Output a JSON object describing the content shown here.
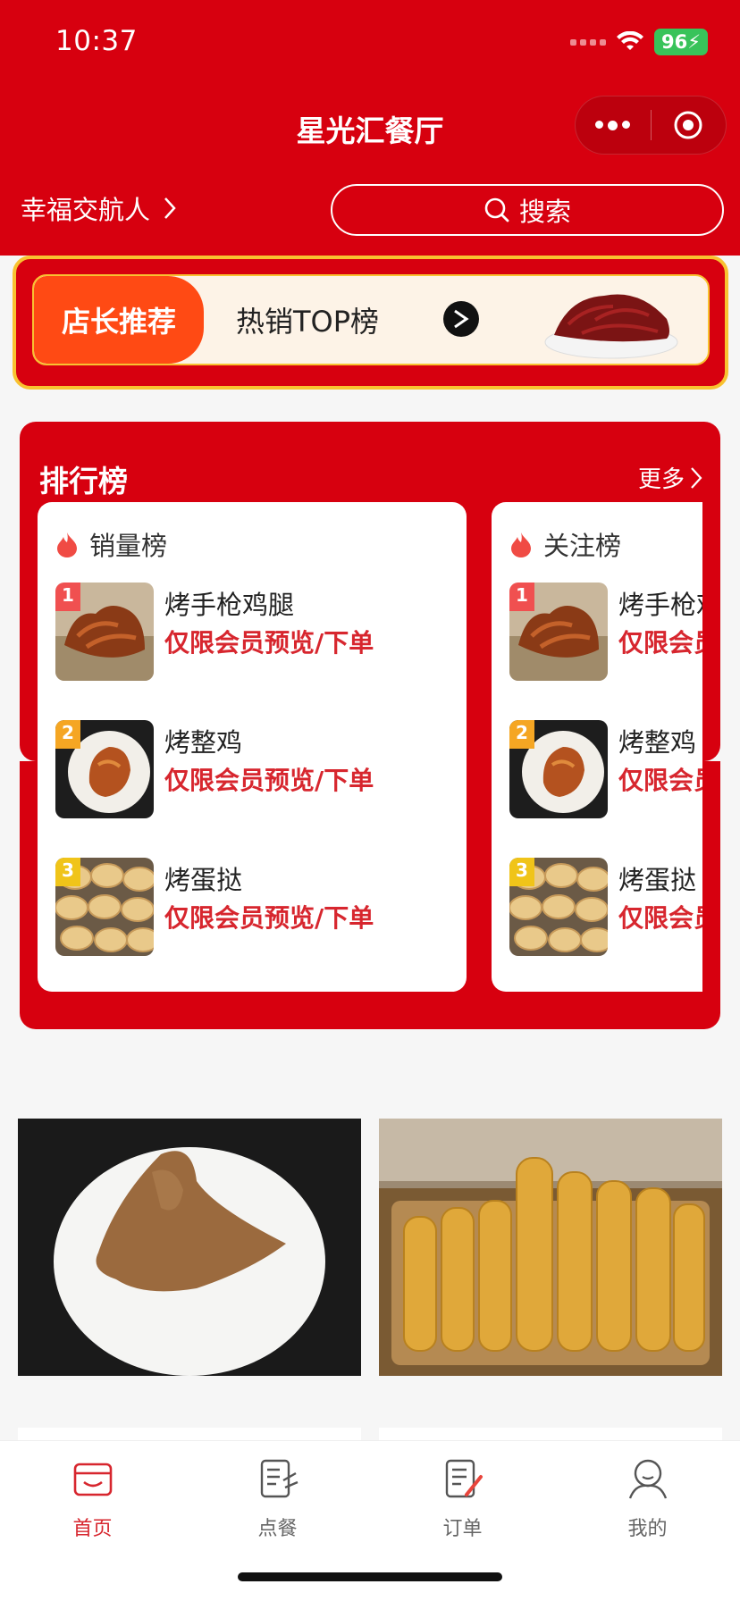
{
  "status_bar": {
    "time": "10:37",
    "battery": "96"
  },
  "header": {
    "title": "星光汇餐厅",
    "store_name": "幸福交航人",
    "search_label": "搜索"
  },
  "banner": {
    "tag": "店长推荐",
    "text": "热销TOP榜"
  },
  "ranking": {
    "title": "排行榜",
    "more_label": "更多",
    "lists": [
      {
        "title": "销量榜",
        "items": [
          {
            "rank": "1",
            "name": "烤手枪鸡腿",
            "note": "仅限会员预览/下单"
          },
          {
            "rank": "2",
            "name": "烤整鸡",
            "note": "仅限会员预览/下单"
          },
          {
            "rank": "3",
            "name": "烤蛋挞",
            "note": "仅限会员预览/下单"
          }
        ]
      },
      {
        "title": "关注榜",
        "items": [
          {
            "rank": "1",
            "name": "烤手枪鸡腿",
            "note": "仅限会员预览/下单"
          },
          {
            "rank": "2",
            "name": "烤整鸡",
            "note": "仅限会员预览/下单"
          },
          {
            "rank": "3",
            "name": "烤蛋挞",
            "note": "仅限会员预览/下单"
          }
        ]
      }
    ]
  },
  "tabbar": {
    "items": [
      {
        "label": "首页",
        "icon": "home-icon",
        "active": true
      },
      {
        "label": "点餐",
        "icon": "menu-icon",
        "active": false
      },
      {
        "label": "订单",
        "icon": "order-icon",
        "active": false
      },
      {
        "label": "我的",
        "icon": "profile-icon",
        "active": false
      }
    ]
  },
  "colors": {
    "brand_red": "#d7000f",
    "accent_orange": "#ff4a14",
    "gold": "#f8c230",
    "text_red": "#d7262e"
  }
}
